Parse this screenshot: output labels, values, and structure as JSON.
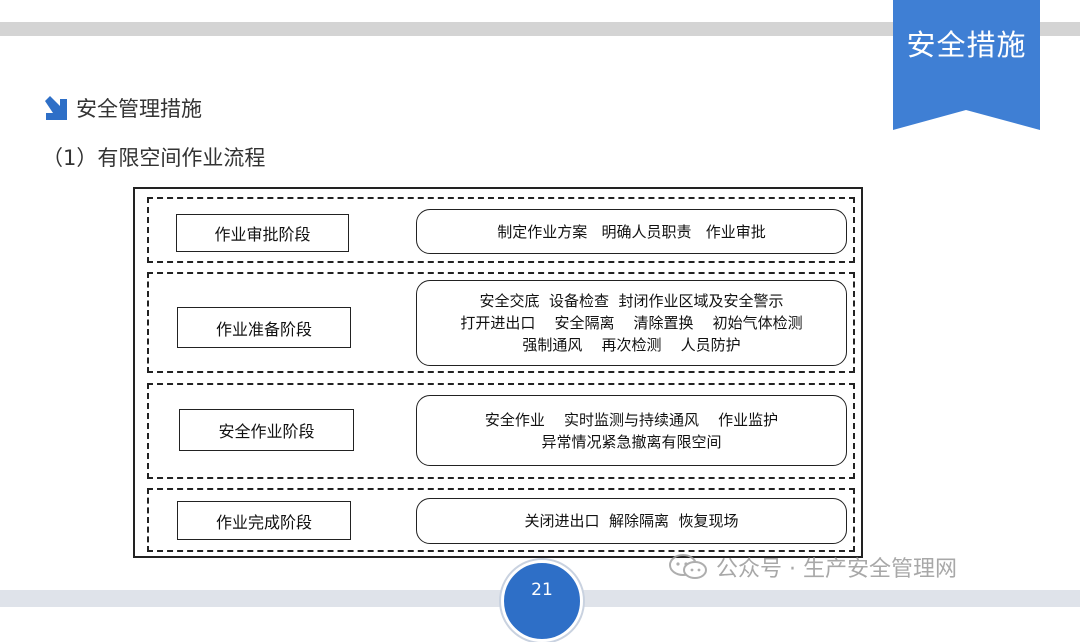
{
  "badge": {
    "title": "安全措施"
  },
  "heading": {
    "text": "安全管理措施"
  },
  "subheading": {
    "text": "（1）有限空间作业流程"
  },
  "stages": [
    {
      "label": "作业审批阶段",
      "lines": [
        "制定作业方案   明确人员职责   作业审批"
      ]
    },
    {
      "label": "作业准备阶段",
      "lines": [
        "安全交底  设备检查  封闭作业区域及安全警示",
        "打开进出口    安全隔离    清除置换    初始气体检测",
        "强制通风    再次检测    人员防护"
      ]
    },
    {
      "label": "安全作业阶段",
      "lines": [
        "安全作业    实时监测与持续通风    作业监护",
        "异常情况紧急撤离有限空间"
      ]
    },
    {
      "label": "作业完成阶段",
      "lines": [
        "关闭进出口  解除隔离  恢复现场"
      ]
    }
  ],
  "page_number": "21",
  "watermark": {
    "text": "公众号 · 生产安全管理网"
  },
  "colors": {
    "accent": "#2e6fc7",
    "badge": "#3f7fd4",
    "top_bar": "#d4d4d4"
  }
}
